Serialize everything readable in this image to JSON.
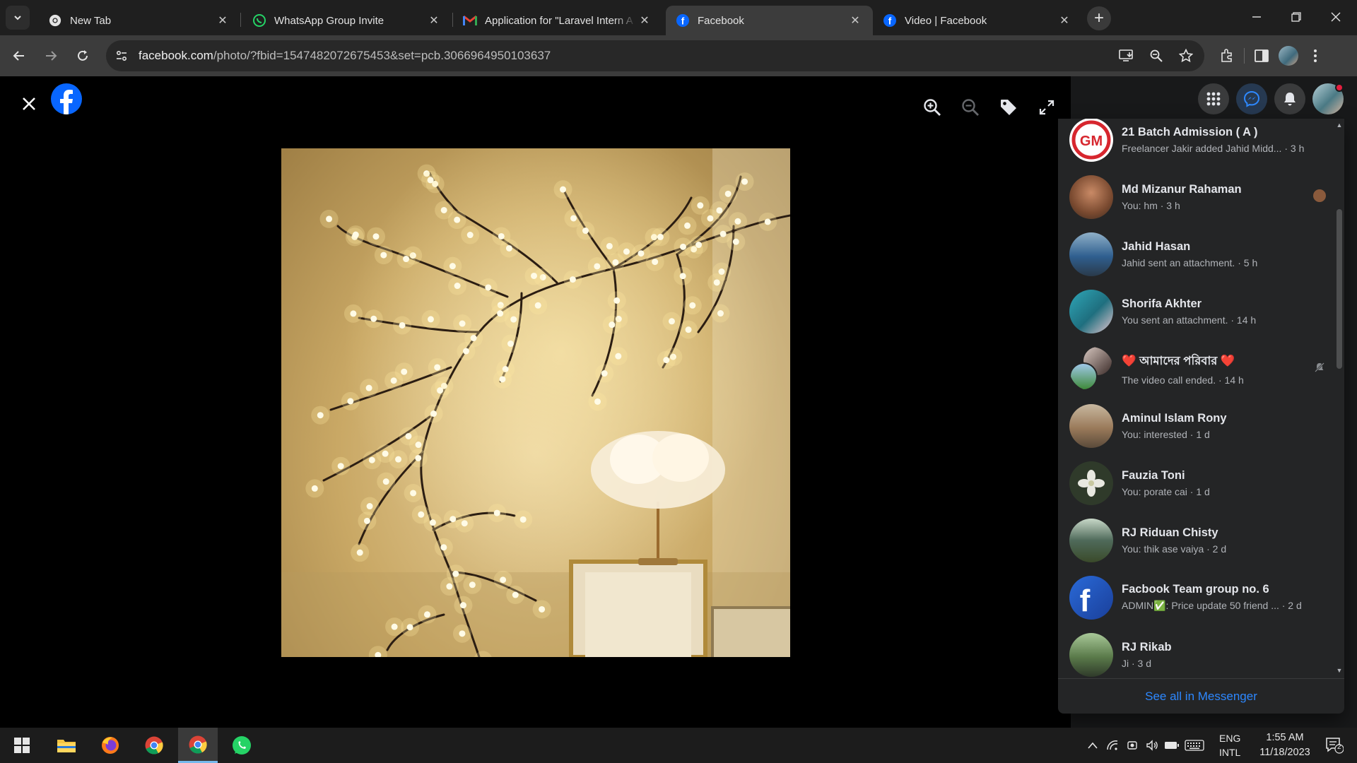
{
  "browser": {
    "tabs": [
      {
        "title": "New Tab",
        "favicon": "chrome-icon",
        "active": false
      },
      {
        "title": "WhatsApp Group Invite",
        "favicon": "whatsapp-icon",
        "active": false
      },
      {
        "title": "Application for \"Laravel Intern A",
        "favicon": "gmail-icon",
        "active": false
      },
      {
        "title": "Facebook",
        "favicon": "facebook-icon",
        "active": true
      },
      {
        "title": "Video | Facebook",
        "favicon": "facebook-icon",
        "active": false
      }
    ],
    "url_host": "facebook.com",
    "url_path": "/photo/?fbid=1547482072675453&set=pcb.3066964950103637"
  },
  "messenger": {
    "chats": [
      {
        "name": "21 Batch Admission ( A )",
        "preview": "Freelancer Jakir added Jahid Midd... · 3 h",
        "avatar_color": "#ffffff",
        "mark": ""
      },
      {
        "name": "Md Mizanur Rahaman",
        "preview": "You: hm · 3 h",
        "avatar_color": "#8a5a3c",
        "mark": "seen-avatar"
      },
      {
        "name": "Jahid Hasan",
        "preview": "Jahid sent an attachment. · 5 h",
        "avatar_color": "#3f6f8f",
        "mark": ""
      },
      {
        "name": "Shorifa Akhter",
        "preview": "You sent an attachment. · 14 h",
        "avatar_color": "#2f8fa0",
        "mark": ""
      },
      {
        "name": "❤️ আমাদের পরিবার ❤️",
        "preview": "The video call ended. · 14 h",
        "avatar_color": "#4a6a3a",
        "mark": "muted-bell"
      },
      {
        "name": "Aminul Islam Rony",
        "preview": "You: interested · 1 d",
        "avatar_color": "#9a7a5a",
        "mark": ""
      },
      {
        "name": "Fauzia Toni",
        "preview": "You: porate cai · 1 d",
        "avatar_color": "#2f3a2a",
        "mark": ""
      },
      {
        "name": "RJ Riduan Chisty",
        "preview": "You: thik ase vaiya · 2 d",
        "avatar_color": "#4f6a5a",
        "mark": ""
      },
      {
        "name": "Facbook Team group no. 6",
        "preview": "ADMIN✅: Price update 50 friend ... · 2 d",
        "avatar_color": "#1a4fb0",
        "mark": ""
      },
      {
        "name": "RJ Rikab",
        "preview": "Ji · 3 d",
        "avatar_color": "#5a7a4a",
        "mark": ""
      }
    ],
    "see_all": "See all in Messenger"
  },
  "taskbar": {
    "apps": [
      "windows-start-icon",
      "file-explorer-icon",
      "firefox-icon",
      "chrome-icon",
      "chrome-active-icon",
      "whatsapp-icon"
    ],
    "lang_line1": "ENG",
    "lang_line2": "INTL",
    "time": "1:55 AM",
    "date": "11/18/2023",
    "notification_count": "2"
  },
  "colors": {
    "facebook_blue": "#0866ff",
    "link_blue": "#2d88ff",
    "panel_bg": "#242526"
  }
}
